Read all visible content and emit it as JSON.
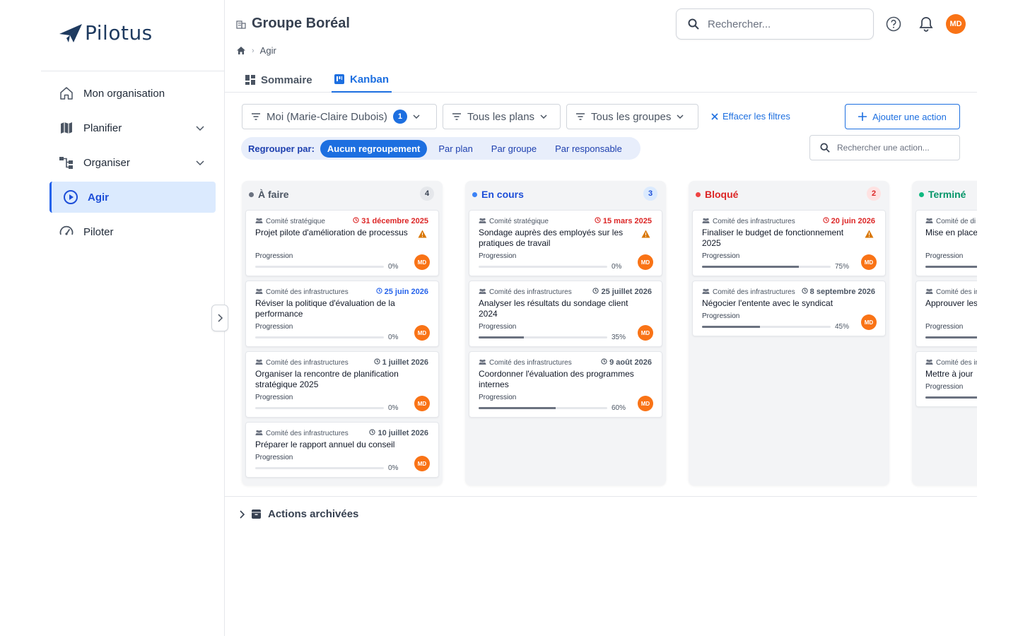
{
  "app": {
    "logo_text": "Pilotus"
  },
  "sidebar": {
    "items": [
      {
        "label": "Mon organisation",
        "icon": "home-icon",
        "has_chevron": false,
        "active": false
      },
      {
        "label": "Planifier",
        "icon": "map-icon",
        "has_chevron": true,
        "active": false
      },
      {
        "label": "Organiser",
        "icon": "org-chart-icon",
        "has_chevron": true,
        "active": false
      },
      {
        "label": "Agir",
        "icon": "play-circle-icon",
        "has_chevron": false,
        "active": true
      },
      {
        "label": "Piloter",
        "icon": "gauge-icon",
        "has_chevron": false,
        "active": false
      }
    ]
  },
  "header": {
    "org_name": "Groupe Boréal",
    "breadcrumb_current": "Agir",
    "search_placeholder": "Rechercher...",
    "avatar_initials": "MD"
  },
  "tabs": [
    {
      "label": "Sommaire",
      "icon": "dashboard-icon",
      "active": false
    },
    {
      "label": "Kanban",
      "icon": "kanban-icon",
      "active": true
    }
  ],
  "filters": {
    "owner_label": "Moi (Marie-Claire Dubois)",
    "owner_count": "1",
    "plans_label": "Tous les plans",
    "groups_label": "Tous les groupes",
    "clear_label": "Effacer les filtres",
    "add_action_label": "Ajouter une action",
    "group_by_label": "Regrouper par:",
    "group_options": [
      "Aucun regroupement",
      "Par plan",
      "Par groupe",
      "Par responsable"
    ],
    "group_selected": "Aucun regroupement",
    "action_search_placeholder": "Rechercher une action..."
  },
  "progress_label": "Progression",
  "colors": {
    "accent": "#1d6fe0",
    "todo": "#6b7280",
    "in_progress": "#3b82f6",
    "blocked": "#ef4444",
    "done": "#10b981",
    "overdue": "#dc2626",
    "upcoming": "#2563eb",
    "warning": "#d97706",
    "avatar": "#f97316"
  },
  "columns": [
    {
      "title": "À faire",
      "count": "4",
      "dot_color": "#6b7280",
      "title_color": "#4b5563",
      "count_bg": "#e5e7eb",
      "count_color": "#374151",
      "cards": [
        {
          "group": "Comité stratégique",
          "date": "31 décembre 2025",
          "date_status": "overdue",
          "title": "Projet pilote d'amélioration de processus",
          "warning": true,
          "progress": 0,
          "progress_text": "0%",
          "avatar": "MD"
        },
        {
          "group": "Comité des infrastructures",
          "date": "25 juin 2026",
          "date_status": "upcoming",
          "title": "Réviser la politique d'évaluation de la performance",
          "warning": false,
          "progress": 0,
          "progress_text": "0%",
          "avatar": "MD"
        },
        {
          "group": "Comité des infrastructures",
          "date": "1 juillet 2026",
          "date_status": "normal",
          "title": "Organiser la rencontre de planification stratégique 2025",
          "warning": false,
          "progress": 0,
          "progress_text": "0%",
          "avatar": "MD"
        },
        {
          "group": "Comité des infrastructures",
          "date": "10 juillet 2026",
          "date_status": "normal",
          "title": "Préparer le rapport annuel du conseil",
          "warning": false,
          "progress": 0,
          "progress_text": "0%",
          "avatar": "MD"
        }
      ]
    },
    {
      "title": "En cours",
      "count": "3",
      "dot_color": "#3b82f6",
      "title_color": "#1d4ed8",
      "count_bg": "#dbeafe",
      "count_color": "#1d4ed8",
      "cards": [
        {
          "group": "Comité stratégique",
          "date": "15 mars 2025",
          "date_status": "overdue",
          "title": "Sondage auprès des employés sur les pratiques de travail",
          "warning": true,
          "progress": 0,
          "progress_text": "0%",
          "avatar": "MD"
        },
        {
          "group": "Comité des infrastructures",
          "date": "25 juillet 2026",
          "date_status": "normal",
          "title": "Analyser les résultats du sondage client 2024",
          "warning": false,
          "progress": 35,
          "progress_text": "35%",
          "avatar": "MD"
        },
        {
          "group": "Comité des infrastructures",
          "date": "9 août 2026",
          "date_status": "normal",
          "title": "Coordonner l'évaluation des programmes internes",
          "warning": false,
          "progress": 60,
          "progress_text": "60%",
          "avatar": "MD"
        }
      ]
    },
    {
      "title": "Bloqué",
      "count": "2",
      "dot_color": "#ef4444",
      "title_color": "#dc2626",
      "count_bg": "#fee2e2",
      "count_color": "#dc2626",
      "cards": [
        {
          "group": "Comité des infrastructures",
          "date": "20 juin 2026",
          "date_status": "overdue",
          "title": "Finaliser le budget de fonctionnement 2025",
          "warning": true,
          "progress": 75,
          "progress_text": "75%",
          "avatar": "MD"
        },
        {
          "group": "Comité des infrastructures",
          "date": "8 septembre 2026",
          "date_status": "normal",
          "title": "Négocier l'entente avec le syndicat",
          "warning": false,
          "progress": 45,
          "progress_text": "45%",
          "avatar": "MD"
        }
      ]
    },
    {
      "title": "Terminé",
      "count": "",
      "dot_color": "#10b981",
      "title_color": "#059669",
      "count_bg": "#d1fae5",
      "count_color": "#059669",
      "cards": [
        {
          "group": "Comité de di",
          "date": "",
          "date_status": "normal",
          "title": "Mise en place performance",
          "warning": false,
          "progress": 100,
          "progress_text": "",
          "avatar": ""
        },
        {
          "group": "Comité des in",
          "date": "",
          "date_status": "normal",
          "title": "Approuver les stratégiques",
          "warning": false,
          "progress": 100,
          "progress_text": "",
          "avatar": ""
        },
        {
          "group": "Comité des in",
          "date": "",
          "date_status": "normal",
          "title": "Mettre à jour",
          "warning": false,
          "progress": 100,
          "progress_text": "",
          "avatar": ""
        }
      ]
    }
  ],
  "archived_label": "Actions archivées"
}
